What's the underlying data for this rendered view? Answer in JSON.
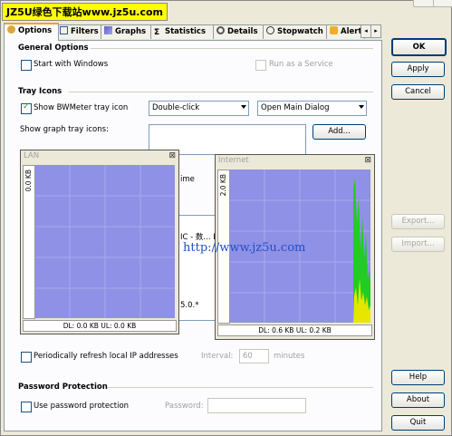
{
  "watermark": "JZ5U绿色下载站www.jz5u.com",
  "watermark_url": "http://www.jz5u.com",
  "tabs": [
    {
      "label": "Options",
      "icon": "options-icon",
      "active": true
    },
    {
      "label": "Filters",
      "icon": "filters-icon"
    },
    {
      "label": "Graphs",
      "icon": "graphs-icon"
    },
    {
      "label": "Statistics",
      "icon": "statistics-icon"
    },
    {
      "label": "Details",
      "icon": "details-icon"
    },
    {
      "label": "Stopwatch",
      "icon": "stopwatch-icon"
    },
    {
      "label": "Alert",
      "icon": "alert-icon"
    }
  ],
  "general": {
    "title": "General Options",
    "start_with_windows": "Start with Windows",
    "run_as_service": "Run as a Service"
  },
  "tray": {
    "title": "Tray Icons",
    "show_tray_icon": "Show BWMeter tray icon",
    "click_action": "Double-click",
    "open_action": "Open Main Dialog",
    "show_graph_tray_icons": "Show graph tray icons:",
    "add": "Add...",
    "partial_time": "ime",
    "partial_list1": "IC - 数... L",
    "partial_list2": "5.0.*"
  },
  "lan_graph": {
    "title": "LAN",
    "ylabel": "0.0 KB",
    "footer": "DL: 0.0 KB   UL: 0.0 KB"
  },
  "internet_graph": {
    "title": "Internet",
    "ylabel": "2.0 KB",
    "footer": "DL: 0.6 KB   UL: 0.2 KB"
  },
  "refresh": {
    "label": "Periodically refresh local IP addresses",
    "interval_label": "Interval:",
    "interval_value": "60",
    "unit": "minutes"
  },
  "password": {
    "title": "Password Protection",
    "use_label": "Use password protection",
    "password_label": "Password:"
  },
  "buttons": {
    "ok": "OK",
    "apply": "Apply",
    "cancel": "Cancel",
    "export": "Export...",
    "import": "Import...",
    "help": "Help",
    "about": "About",
    "quit": "Quit"
  },
  "colors": {
    "graph_background": "#8f91e6",
    "download": "#22cc22",
    "upload": "#e6e600"
  }
}
